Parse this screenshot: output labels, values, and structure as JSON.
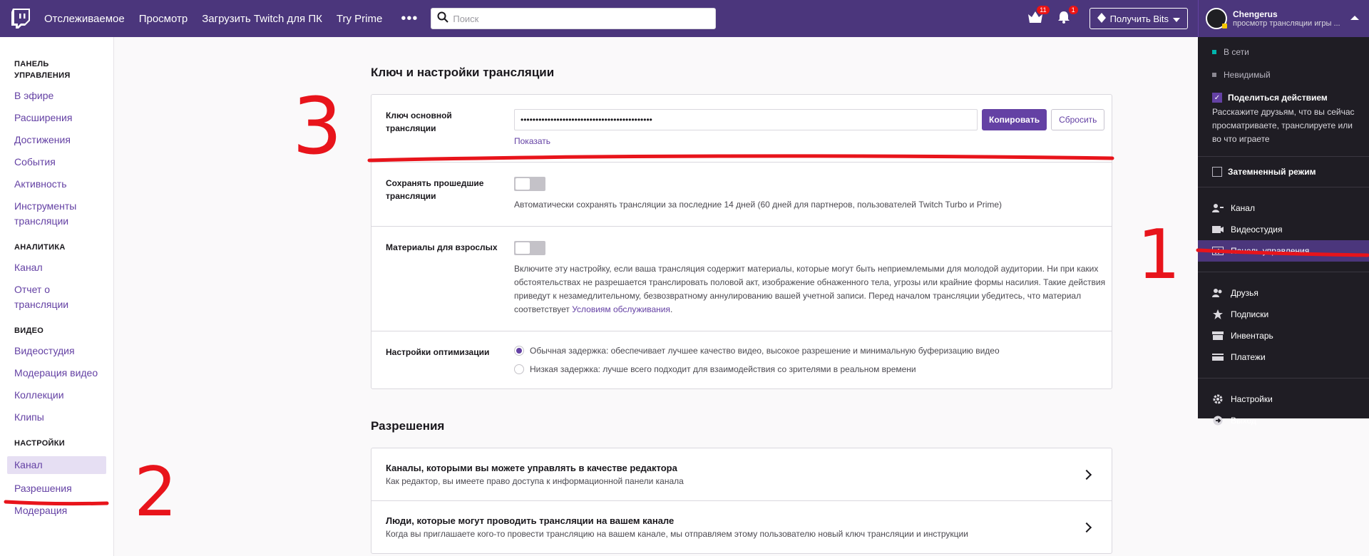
{
  "topbar": {
    "nav": [
      "Отслеживаемое",
      "Просмотр",
      "Загрузить Twitch для ПК",
      "Try Prime"
    ],
    "more": "•••",
    "search_placeholder": "Поиск",
    "crown_badge": "11",
    "bell_badge": "1",
    "bits_label": "Получить Bits",
    "user_name": "Chengerus",
    "user_status": "просмотр трансляции игры ..."
  },
  "sidebar": {
    "groups": [
      {
        "head": "Панель управления",
        "items": [
          "В эфире",
          "Расширения",
          "Достижения",
          "События",
          "Активность",
          "Инструменты трансляции"
        ]
      },
      {
        "head": "Аналитика",
        "items": [
          "Канал",
          "Отчет о трансляции"
        ]
      },
      {
        "head": "Видео",
        "items": [
          "Видеостудия",
          "Модерация видео",
          "Коллекции",
          "Клипы"
        ]
      },
      {
        "head": "Настройки",
        "items": [
          "Канал",
          "Разрешения",
          "Модерация"
        ]
      }
    ]
  },
  "main": {
    "stream_section_title": "Ключ и настройки трансляции",
    "key_label": "Ключ основной трансляции",
    "key_value": "••••••••••••••••••••••••••••••••••••••••••••",
    "copy_label": "Копировать",
    "reset_label": "Сбросить",
    "show_label": "Показать",
    "save_past_label": "Сохранять прошедшие трансляции",
    "save_past_desc": "Автоматически сохранять трансляции за последние 14 дней (60 дней для партнеров, пользователей Twitch Turbo и Prime)",
    "adult_label": "Материалы для взрослых",
    "adult_desc": "Включите эту настройку, если ваша трансляция содержит материалы, которые могут быть неприемлемыми для молодой аудитории. Ни при каких обстоятельствах не разрешается транслировать половой акт, изображение обнаженного тела, угрозы или крайние формы насилия. Такие действия приведут к незамедлительному, безвозвратному аннулированию вашей учетной записи. Перед началом трансляции убедитесь, что материал соответствует",
    "adult_link": "Условиям обслуживания",
    "adult_dot": ".",
    "opt_label": "Настройки оптимизации",
    "opt_normal": "Обычная задержка: обеспечивает лучшее качество видео, высокое разрешение и минимальную буферизацию видео",
    "opt_low": "Низкая задержка: лучше всего подходит для взаимодействия со зрителями в реальном времени",
    "perm_section_title": "Разрешения",
    "perm_1_title": "Каналы, которыми вы можете управлять в качестве редактора",
    "perm_1_sub": "Как редактор, вы имеете право доступа к информационной панели канала",
    "perm_2_title": "Люди, которые могут проводить трансляции на вашем канале",
    "perm_2_sub": "Когда вы приглашаете кого-то провести трансляцию на вашем канале, мы отправляем этому пользователю новый ключ трансляции и инструкции"
  },
  "dropdown": {
    "online": "В сети",
    "invisible": "Невидимый",
    "share_label": "Поделиться действием",
    "share_note": "Расскажите друзьям, что вы сейчас просматриваете, транслируете или во что играете",
    "dark_mode": "Затемненный режим",
    "items_1": [
      "Канал",
      "Видеостудия",
      "Панель управления"
    ],
    "items_2": [
      "Друзья",
      "Подписки",
      "Инвентарь",
      "Платежи"
    ],
    "items_3": [
      "Настройки",
      "Выход"
    ]
  },
  "annotations": {
    "one": "1",
    "two": "2",
    "three": "3"
  },
  "colors": {
    "brand": "#6441a4",
    "topbar": "#4b367c",
    "marker": "#e8141b"
  }
}
